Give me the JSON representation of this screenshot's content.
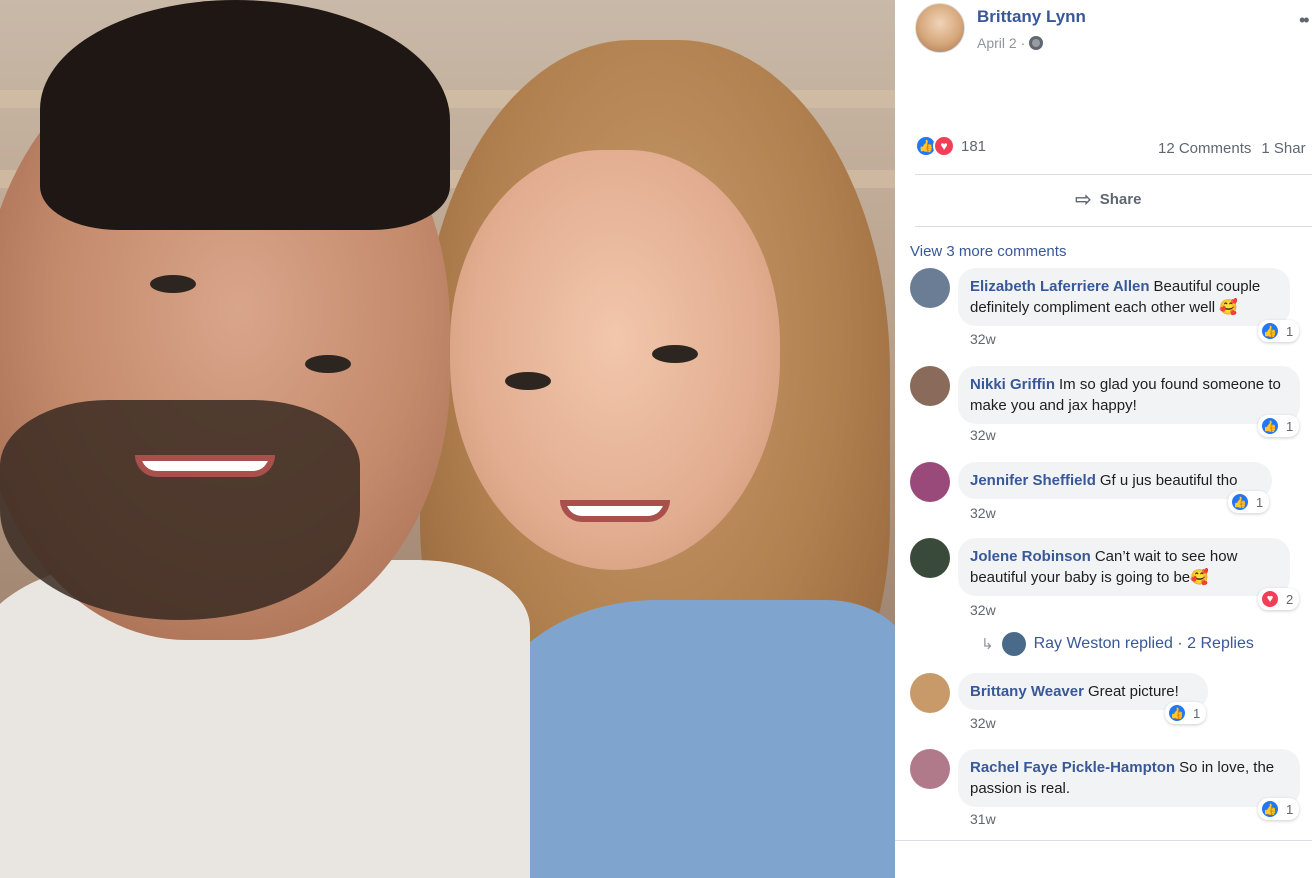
{
  "post": {
    "author": "Brittany Lynn",
    "date": "April 2 ·",
    "reaction_count": "181",
    "comments_count": "12 Comments",
    "shares_count": "1 Shar",
    "share_label": "Share",
    "view_more": "View 3 more comments"
  },
  "comments": [
    {
      "name": "Elizabeth Laferriere Allen",
      "text": "Beautiful couple definitely compliment each other well 🥰",
      "time": "32w",
      "reaction": "like",
      "reaction_count": "1",
      "avatar_color": "#6a7d94"
    },
    {
      "name": "Nikki Griffin",
      "text": "Im so glad you found someone to make you and jax happy!",
      "time": "32w",
      "reaction": "like",
      "reaction_count": "1",
      "avatar_color": "#8a6a5a"
    },
    {
      "name": "Jennifer Sheffield",
      "text": "Gf u jus beautiful tho",
      "time": "32w",
      "reaction": "like",
      "reaction_count": "1",
      "avatar_color": "#9a4a7a"
    },
    {
      "name": "Jolene Robinson",
      "text": "Can’t wait to see how beautiful your baby is going to be🥰",
      "time": "32w",
      "reaction": "love",
      "reaction_count": "2",
      "avatar_color": "#3a4a3a"
    },
    {
      "name": "Brittany Weaver",
      "text": "Great picture!",
      "time": "32w",
      "reaction": "like",
      "reaction_count": "1",
      "avatar_color": "#c89a6a"
    },
    {
      "name": "Rachel Faye Pickle-Hampton",
      "text": "So in love, the passion is real.",
      "time": "31w",
      "reaction": "like",
      "reaction_count": "1",
      "avatar_color": "#b07a8a"
    }
  ],
  "reply": {
    "name": "Ray Weston replied",
    "separator": "·",
    "count": "2 Replies"
  },
  "colors": {
    "link": "#385898",
    "like": "#2078f4",
    "love": "#f33e58",
    "bubble": "#f2f3f5"
  }
}
